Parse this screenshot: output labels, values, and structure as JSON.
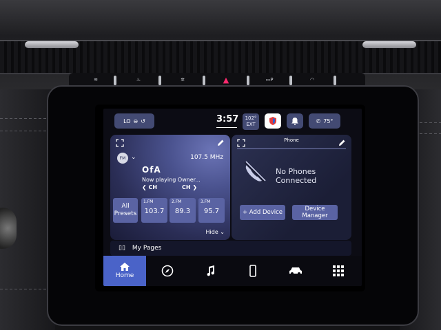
{
  "hardware": {
    "hazard_symbol": "▲",
    "button_icons": [
      "defrost-rear-icon",
      "seat-heat-icon",
      "seat-vent-icon",
      "hazard-icon",
      "park-assist-icon",
      "sport-mode-icon"
    ]
  },
  "status_bar": {
    "climate_label": "LO",
    "time": "3:57",
    "outside_temp": "102°",
    "outside_label": "EXT",
    "cabin_temp": "75°"
  },
  "radio": {
    "band_badge": "FM",
    "frequency": "107.5 MHz",
    "station_logo": "OfA",
    "now_playing": "Now playing Owner...",
    "ch_prev": "CH",
    "ch_next": "CH",
    "all_presets": "All Presets",
    "presets": [
      {
        "label": "1.FM",
        "value": "103.7"
      },
      {
        "label": "2.FM",
        "value": "89.3"
      },
      {
        "label": "3.FM",
        "value": "95.7"
      }
    ],
    "hide_label": "Hide"
  },
  "phone": {
    "title": "Phone",
    "status": "No Phones Connected",
    "add_device": "+ Add Device",
    "device_manager": "Device Manager"
  },
  "mypages_label": "My Pages",
  "nav": {
    "home_label": "Home",
    "items": [
      "home-icon",
      "nav-compass-icon",
      "music-note-icon",
      "smartphone-icon",
      "car-icon",
      "apps-grid-icon"
    ]
  },
  "colors": {
    "accent": "#4a63c8",
    "tile": "#5a63a3",
    "hazard": "#ff2a6e"
  }
}
